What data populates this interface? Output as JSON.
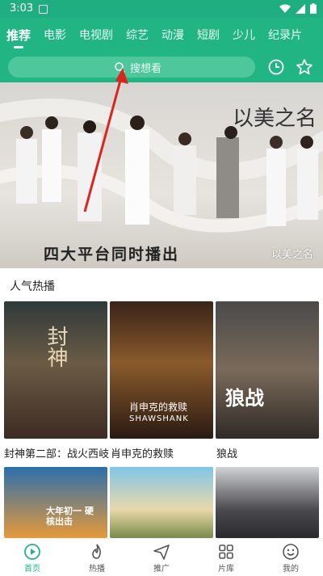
{
  "status": {
    "time": "3:03"
  },
  "tabs": [
    "推荐",
    "电影",
    "电视剧",
    "综艺",
    "动漫",
    "短剧",
    "少儿",
    "纪录片"
  ],
  "search": {
    "placeholder": "搜想看"
  },
  "header_icons": [
    "history-icon",
    "star-icon"
  ],
  "banner": {
    "logo": "以美之名",
    "slogan": "四大平台同时播出",
    "subtitle": "以美之名"
  },
  "section": {
    "title": "人气热播"
  },
  "posters": [
    {
      "title": "封神第二部：战火西岐",
      "art_text": "封神"
    },
    {
      "title": "肖申克的救赎",
      "art_text": "肖申克的救赎",
      "art_sub": "SHAWSHANK"
    },
    {
      "title": "狼战",
      "art_text": "狼战"
    }
  ],
  "posters_row2_text": [
    "大年初一 硬核出击",
    "",
    ""
  ],
  "bottom_nav": [
    {
      "label": "首页",
      "icon": "home-play-icon",
      "active": true
    },
    {
      "label": "热播",
      "icon": "flame-icon"
    },
    {
      "label": "推广",
      "icon": "send-icon"
    },
    {
      "label": "片库",
      "icon": "grid-icon"
    },
    {
      "label": "我的",
      "icon": "smile-icon"
    }
  ],
  "colors": {
    "accent": "#22b584",
    "arrow": "#d8261f"
  }
}
